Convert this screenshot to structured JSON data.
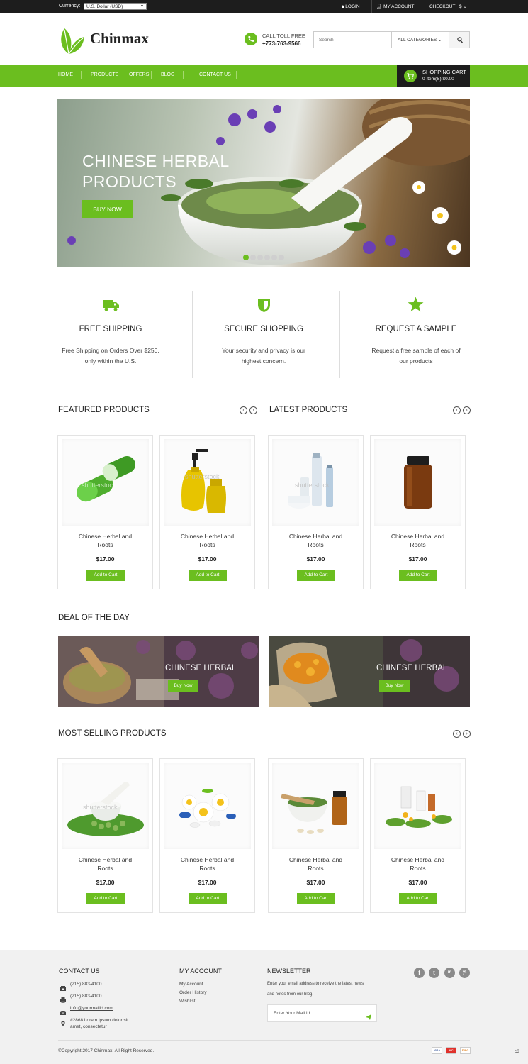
{
  "topbar": {
    "currency_label": "Currency:",
    "currency_value": "U.S. Dollar (USD)",
    "login": "LOGIN",
    "my_account": "MY ACCOUNT",
    "checkout": "CHECKOUT",
    "currency_symbol": "$"
  },
  "header": {
    "logo": "Chinmax",
    "call_label": "CALL TOLL FREE",
    "phone": "+773-763-9566",
    "search_placeholder": "Search",
    "categories": "ALL CATEGORIES"
  },
  "nav": {
    "items": [
      "HOME",
      "PRODUCTS",
      "OFFERS",
      "BLOG",
      "CONTACT US"
    ],
    "cart_title": "SHOPPING CART",
    "cart_summary": "0 Item(S) $0.00"
  },
  "hero": {
    "line1": "CHINESE HERBAL",
    "line2": "PRODUCTS",
    "button": "BUY NOW",
    "slides": 6,
    "active_slide": 1
  },
  "features": [
    {
      "title": "FREE SHIPPING",
      "line1": "Free Shipping on Orders Over $250,",
      "line2": "only within the U.S.",
      "icon": "truck-icon"
    },
    {
      "title": "SECURE SHOPPING",
      "line1": "Your security and privacy is our",
      "line2": "highest concern.",
      "icon": "shield-icon"
    },
    {
      "title": "REQUEST A SAMPLE",
      "line1": "Request a free sample of each of",
      "line2": "our products",
      "icon": "star-icon"
    }
  ],
  "sections": {
    "featured": "FEATURED PRODUCTS",
    "latest": "LATEST PRODUCTS",
    "deal": "DEAL OF THE DAY",
    "most_selling": "MOST SELLING PRODUCTS"
  },
  "product": {
    "name": "Chinese Herbal and Roots",
    "price": "$17.00",
    "button": "Add to Cart",
    "watermark": "shutterstock"
  },
  "deals": [
    {
      "title": "CHINESE HERBAL",
      "button": "Buy Now"
    },
    {
      "title": "CHINESE HERBAL",
      "button": "Buy Now"
    }
  ],
  "footer": {
    "contact_title": "CONTACT US",
    "phone1": "(215) 883-4100",
    "phone2": "(215) 883-4100",
    "email": "info@yourmailid.com",
    "address1": "#2868 Lorem ipsum dolor sit",
    "address2": "amet, consectetur",
    "account_title": "MY ACCOUNT",
    "account_links": [
      "My Account",
      "Order History",
      "Wishlist"
    ],
    "newsletter_title": "NEWSLETTER",
    "newsletter_text1": "Enter your email address to receive the latest news",
    "newsletter_text2": "and notes from our blog.",
    "newsletter_placeholder": "Enter Your Mail Id",
    "copyright": "©Copyright 2017  Chinmax. All Right Reserved.",
    "corner": "c3",
    "social": [
      "f",
      "t",
      "in",
      "yt"
    ],
    "payments": [
      "VISA",
      "MC",
      "DISC"
    ]
  },
  "colors": {
    "accent": "#6bbe1f",
    "dark": "#1d1d1d"
  }
}
